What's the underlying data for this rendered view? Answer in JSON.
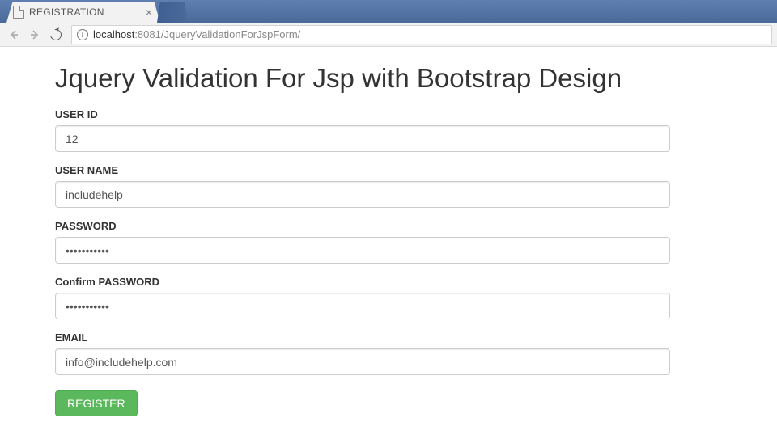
{
  "browser": {
    "tab_title": "REGISTRATION",
    "url_host": "localhost",
    "url_port": ":8081",
    "url_path": "/JqueryValidationForJspForm/"
  },
  "page": {
    "heading": "Jquery Validation For Jsp with Bootstrap Design"
  },
  "form": {
    "user_id": {
      "label": "USER ID",
      "value": "12"
    },
    "user_name": {
      "label": "USER NAME",
      "value": "includehelp"
    },
    "password": {
      "label": "PASSWORD",
      "value": "•••••••••••"
    },
    "confirm_password": {
      "label": "Confirm PASSWORD",
      "value": "•••••••••••"
    },
    "email": {
      "label": "EMAIL",
      "value": "info@includehelp.com"
    },
    "submit_label": "REGISTER"
  }
}
